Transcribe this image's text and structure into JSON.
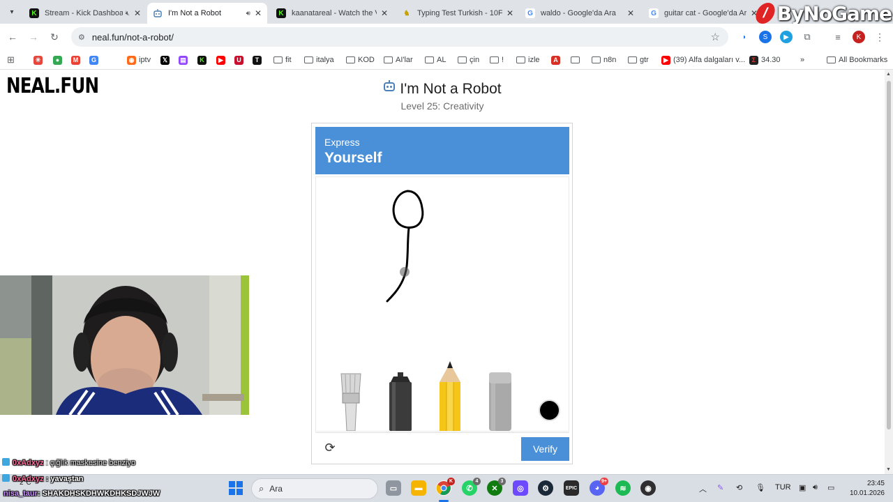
{
  "browser": {
    "tabs": [
      {
        "title": "Stream - Kick Dashboa",
        "icon": "kick-icon",
        "muted": true
      },
      {
        "title": "I'm Not a Robot",
        "icon": "robot-icon",
        "active": true,
        "audio": true
      },
      {
        "title": "kaanatareal - Watch the V",
        "icon": "kick-icon"
      },
      {
        "title": "Typing Test Turkish - 10Fa",
        "icon": "typing-icon"
      },
      {
        "title": "waldo - Google'da Ara",
        "icon": "google-icon"
      },
      {
        "title": "guitar cat - Google'da Ara",
        "icon": "google-icon"
      }
    ],
    "url": "neal.fun/not-a-robot/",
    "profile_initial": "K",
    "bookmarks": [
      "iptv",
      "fit",
      "italya",
      "KOD",
      "AI'lar",
      "AL",
      "çin",
      "!",
      "izle",
      "n8n",
      "gtr",
      "(39) Alfa dalgaları v...",
      "34.30"
    ],
    "all_bookmarks": "All Bookmarks",
    "overflow": "»"
  },
  "overlay": {
    "brand": "ByNoGame",
    "chat": [
      {
        "user": "0xAdxyz",
        "sep": ":",
        "message": "çığlık maskesine benziyo"
      },
      {
        "user": "0xAdxyz",
        "sep": ":",
        "message": "yavaştan"
      },
      {
        "user": "nisa_taur",
        "sep": ":",
        "message": "SHAKDHSKDHWKDHKSDJWJW"
      }
    ]
  },
  "page": {
    "logo": "NEAL.FUN",
    "title": "I'm Not a Robot",
    "level": "Level 25: Creativity",
    "captcha": {
      "prompt_small": "Express",
      "prompt_big": "Yourself",
      "tools": [
        "brush-icon",
        "spray-can-icon",
        "pencil-icon",
        "eraser-icon",
        "color-swatch"
      ],
      "selected_color": "#000000",
      "verify_label": "Verify",
      "accent": "#4a90d9"
    }
  },
  "taskbar": {
    "weather": "2°C",
    "search_placeholder": "Ara",
    "apps": [
      {
        "name": "taskview",
        "badge": ""
      },
      {
        "name": "explorer",
        "badge": ""
      },
      {
        "name": "chrome",
        "badge": "K"
      },
      {
        "name": "whatsapp",
        "badge": "4"
      },
      {
        "name": "xbox",
        "badge": "3"
      },
      {
        "name": "proton",
        "badge": ""
      },
      {
        "name": "steam",
        "badge": ""
      },
      {
        "name": "epic",
        "badge": ""
      },
      {
        "name": "discord",
        "badge": "9+"
      },
      {
        "name": "spotify",
        "badge": ""
      },
      {
        "name": "obs",
        "badge": ""
      }
    ],
    "language": "TUR",
    "time": "23:45",
    "date": "10.01.2026"
  }
}
